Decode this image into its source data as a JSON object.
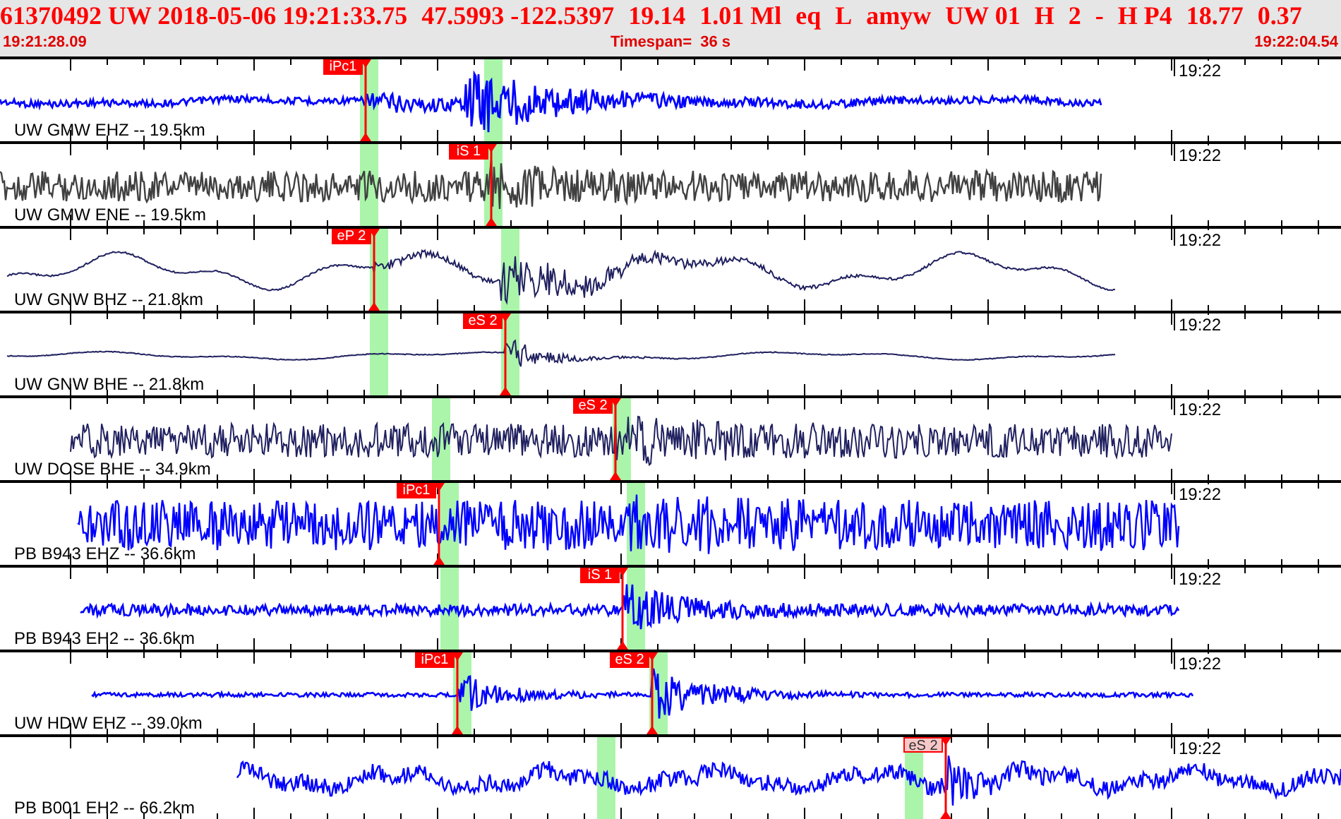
{
  "header": {
    "event_fields": [
      "61370492 UW 2018-05-06 19:21:33.75",
      "47.5993 -122.5397",
      "19.14",
      "1.01 Ml",
      "eq",
      "L",
      "amyw",
      "UW 01",
      "H",
      "2",
      "-",
      "H P4",
      "18.77",
      "0.37"
    ],
    "start_time": "19:21:28.09",
    "timespan": "Timespan=  36 s",
    "end_time": "19:22:04.54"
  },
  "traces": [
    {
      "label": "UW GMW EHZ -- 19.5km",
      "time_label": "19:22",
      "color": "#0000ff",
      "picks": [
        {
          "label": "iPc1",
          "faded": false
        }
      ]
    },
    {
      "label": "UW GMW ENE -- 19.5km",
      "time_label": "19:22",
      "color": "#404040",
      "picks": [
        {
          "label": "iS 1",
          "faded": false
        }
      ]
    },
    {
      "label": "UW GNW BHZ -- 21.8km",
      "time_label": "19:22",
      "color": "#202060",
      "picks": [
        {
          "label": "eP 2",
          "faded": false
        }
      ]
    },
    {
      "label": "UW GNW BHE -- 21.8km",
      "time_label": "19:22",
      "color": "#202060",
      "picks": [
        {
          "label": "eS 2",
          "faded": false
        }
      ]
    },
    {
      "label": "UW DOSE BHE -- 34.9km",
      "time_label": "19:22",
      "color": "#202060",
      "picks": [
        {
          "label": "eS 2",
          "faded": false
        }
      ]
    },
    {
      "label": "PB B943 EHZ -- 36.6km",
      "time_label": "19:22",
      "color": "#0000ff",
      "picks": [
        {
          "label": "iPc1",
          "faded": false
        }
      ]
    },
    {
      "label": "PB B943 EH2 -- 36.6km",
      "time_label": "19:22",
      "color": "#0000ff",
      "picks": [
        {
          "label": "iS 1",
          "faded": false
        }
      ]
    },
    {
      "label": "UW HDW EHZ -- 39.0km",
      "time_label": "19:22",
      "color": "#0000ff",
      "picks": [
        {
          "label": "iPc1",
          "faded": false
        },
        {
          "label": "eS 2",
          "faded": false
        }
      ]
    },
    {
      "label": "PB B001 EH2 -- 66.2km",
      "time_label": "19:22",
      "color": "#0000ff",
      "picks": [
        {
          "label": "eS 2",
          "faded": true
        }
      ]
    }
  ]
}
